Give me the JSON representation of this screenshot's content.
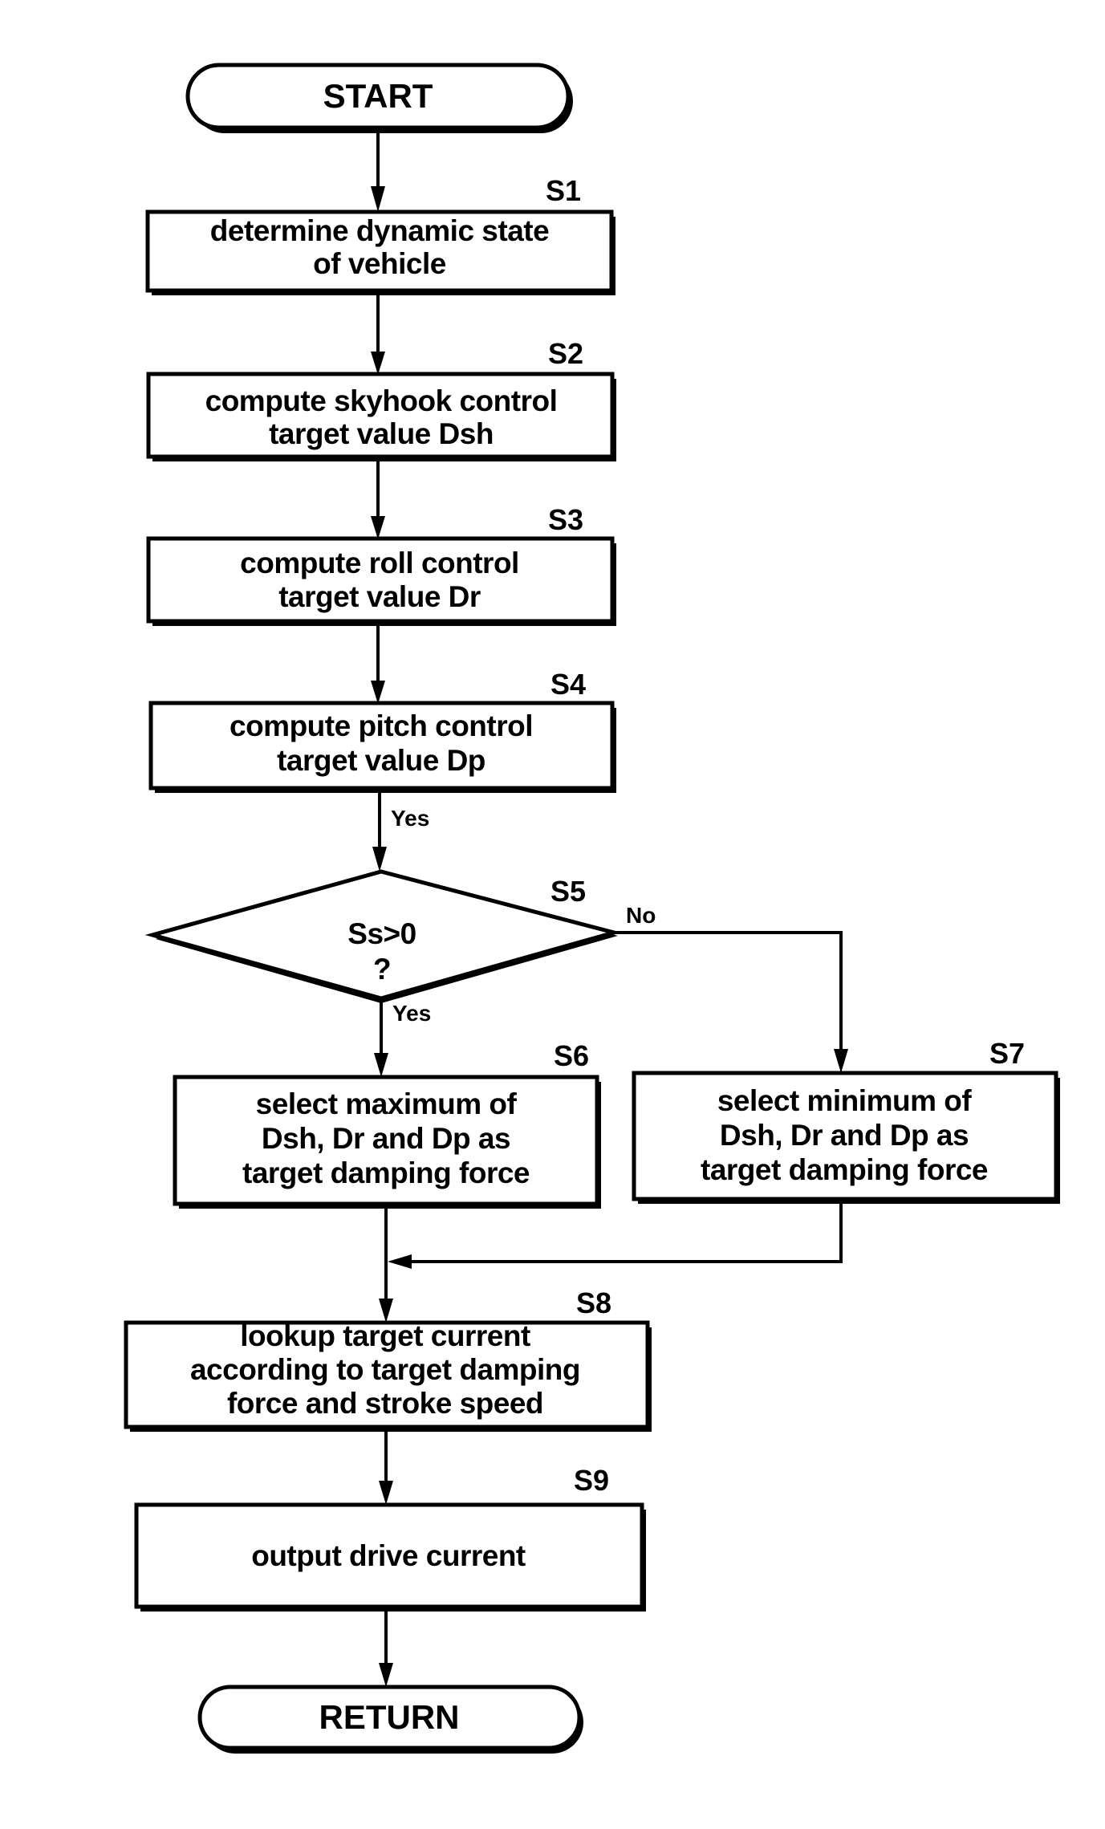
{
  "flowchart": {
    "start": {
      "label": "START"
    },
    "end": {
      "label": "RETURN"
    },
    "steps": [
      {
        "id": "S1",
        "lines": [
          "determine dynamic state",
          "of vehicle"
        ]
      },
      {
        "id": "S2",
        "lines": [
          "compute skyhook control",
          "target value Dsh"
        ]
      },
      {
        "id": "S3",
        "lines": [
          "compute roll control",
          "target value Dr"
        ]
      },
      {
        "id": "S4",
        "lines": [
          "compute pitch control",
          "target value Dp"
        ]
      },
      {
        "id": "S5",
        "lines": [
          "Ss>0",
          "?"
        ],
        "type": "decision"
      },
      {
        "id": "S6",
        "lines": [
          "select maximum of",
          "Dsh, Dr and Dp as",
          "target damping force"
        ]
      },
      {
        "id": "S7",
        "lines": [
          "select minimum of",
          "Dsh, Dr and Dp as",
          "target damping force"
        ]
      },
      {
        "id": "S8",
        "lines": [
          "lookup target current",
          "according to target damping",
          "force and stroke speed"
        ]
      },
      {
        "id": "S9",
        "lines": [
          "output drive current"
        ]
      }
    ],
    "branch_labels": {
      "yes_above": "Yes",
      "yes_below": "Yes",
      "no": "No"
    }
  }
}
